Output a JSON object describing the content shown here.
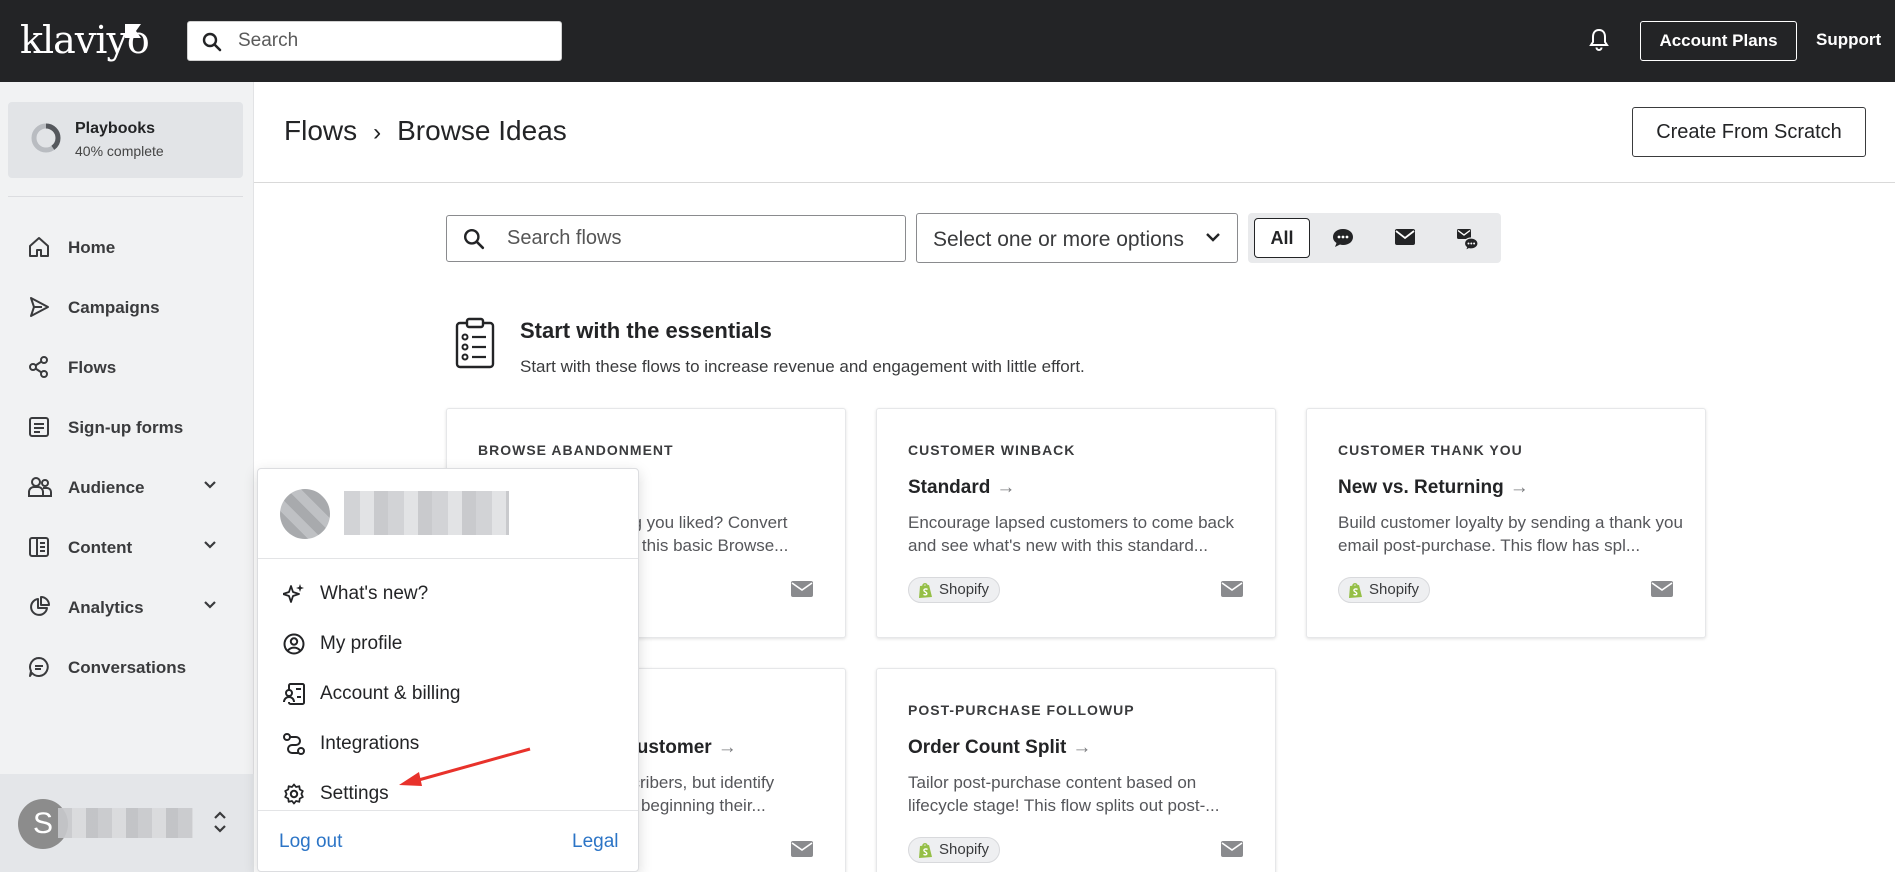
{
  "app": {
    "logo_text": "klaviyo",
    "search_placeholder": "Search",
    "account_plans_label": "Account Plans",
    "support_label": "Support"
  },
  "sidebar": {
    "playbooks": {
      "title": "Playbooks",
      "progress_text": "40% complete",
      "progress": 0.4
    },
    "items": [
      {
        "label": "Home",
        "icon": "home-icon",
        "expandable": false
      },
      {
        "label": "Campaigns",
        "icon": "send-icon",
        "expandable": false
      },
      {
        "label": "Flows",
        "icon": "flows-icon",
        "expandable": false
      },
      {
        "label": "Sign-up forms",
        "icon": "form-icon",
        "expandable": false
      },
      {
        "label": "Audience",
        "icon": "people-icon",
        "expandable": true
      },
      {
        "label": "Content",
        "icon": "content-icon",
        "expandable": true
      },
      {
        "label": "Analytics",
        "icon": "pie-chart-icon",
        "expandable": true
      },
      {
        "label": "Conversations",
        "icon": "chat-icon",
        "expandable": false
      }
    ],
    "user_initial": "S"
  },
  "header": {
    "breadcrumb_root": "Flows",
    "breadcrumb_sep": "›",
    "breadcrumb_current": "Browse Ideas",
    "create_button": "Create From Scratch"
  },
  "filters": {
    "search_placeholder": "Search flows",
    "select_placeholder": "Select one or more options",
    "segments": [
      "All",
      "sms-icon",
      "email-icon",
      "sms-email-icon"
    ]
  },
  "section": {
    "title": "Start with the essentials",
    "subtitle": "Start with these flows to increase revenue and engagement with little effort."
  },
  "cards": [
    {
      "tag": "BROWSE ABANDONMENT",
      "title": "",
      "desc": "ng you liked? Convert\nth this basic Browse...",
      "badge": ""
    },
    {
      "tag": "CUSTOMER WINBACK",
      "title": "Standard",
      "desc": "Encourage lapsed customers to come back and see what's new with this standard...",
      "badge": "Shopify"
    },
    {
      "tag": "CUSTOMER THANK YOU",
      "title": "New vs. Returning",
      "desc": "Build customer loyalty by sending a thank you email post-purchase. This flow has spl...",
      "badge": "Shopify"
    },
    {
      "tag": "",
      "title": "Customer",
      "desc": "scribers, but identify\nst beginning their...",
      "badge": ""
    },
    {
      "tag": "POST-PURCHASE FOLLOWUP",
      "title": "Order Count Split",
      "desc": "Tailor post-purchase content based on lifecycle stage! This flow splits out post-...",
      "badge": "Shopify"
    }
  ],
  "card_arrow": "→",
  "user_menu": {
    "items": [
      {
        "label": "What's new?",
        "icon": "sparkle-icon"
      },
      {
        "label": "My profile",
        "icon": "profile-icon"
      },
      {
        "label": "Account & billing",
        "icon": "billing-icon"
      },
      {
        "label": "Integrations",
        "icon": "integrations-icon"
      },
      {
        "label": "Settings",
        "icon": "gear-icon"
      }
    ],
    "logout_label": "Log out",
    "legal_label": "Legal"
  },
  "colors": {
    "topbar": "#232426",
    "link": "#2b74c6",
    "annotation": "#e8322b",
    "shopify": "#95bf47"
  }
}
